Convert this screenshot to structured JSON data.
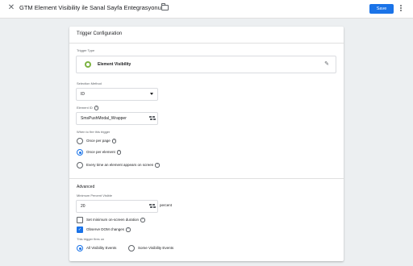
{
  "header": {
    "close_icon": "close-icon",
    "title": "GTM Element Visibility ile Sanal Sayfa Entegrasyonu",
    "folder_icon": "folder-icon",
    "save_label": "Save",
    "menu_icon": "more-vert-icon",
    "accent": "#1a73e8"
  },
  "card": {
    "title": "Trigger Configuration",
    "trigger_type_label": "Trigger Type",
    "trigger_type_name": "Element Visibility",
    "trigger_type_icon": "visibility-icon",
    "trigger_type_color": "#7cb342",
    "edit_icon": "pencil-icon",
    "selection_method_label": "Selection Method",
    "selection_method_value": "ID",
    "element_id_label": "Element ID",
    "element_id_value": "SmsPushModal_Wrapper",
    "fire_label": "When to fire this trigger",
    "fire_options": [
      {
        "label": "Once per page",
        "selected": false
      },
      {
        "label": "Once per element",
        "selected": true
      },
      {
        "label": "Every time an element appears on screen",
        "selected": false
      }
    ],
    "advanced_title": "Advanced",
    "min_percent_label": "Minimum Percent Visible",
    "min_percent_value": "20",
    "percent_suffix": "percent",
    "set_min_duration_label": "Set minimum on-screen duration",
    "set_min_duration_checked": false,
    "observe_dom_label": "Observe DOM changes",
    "observe_dom_checked": true,
    "fires_on_label": "This trigger fires on",
    "fires_on_options": [
      {
        "label": "All Visibility Events",
        "selected": true
      },
      {
        "label": "Some Visibility Events",
        "selected": false
      }
    ]
  }
}
